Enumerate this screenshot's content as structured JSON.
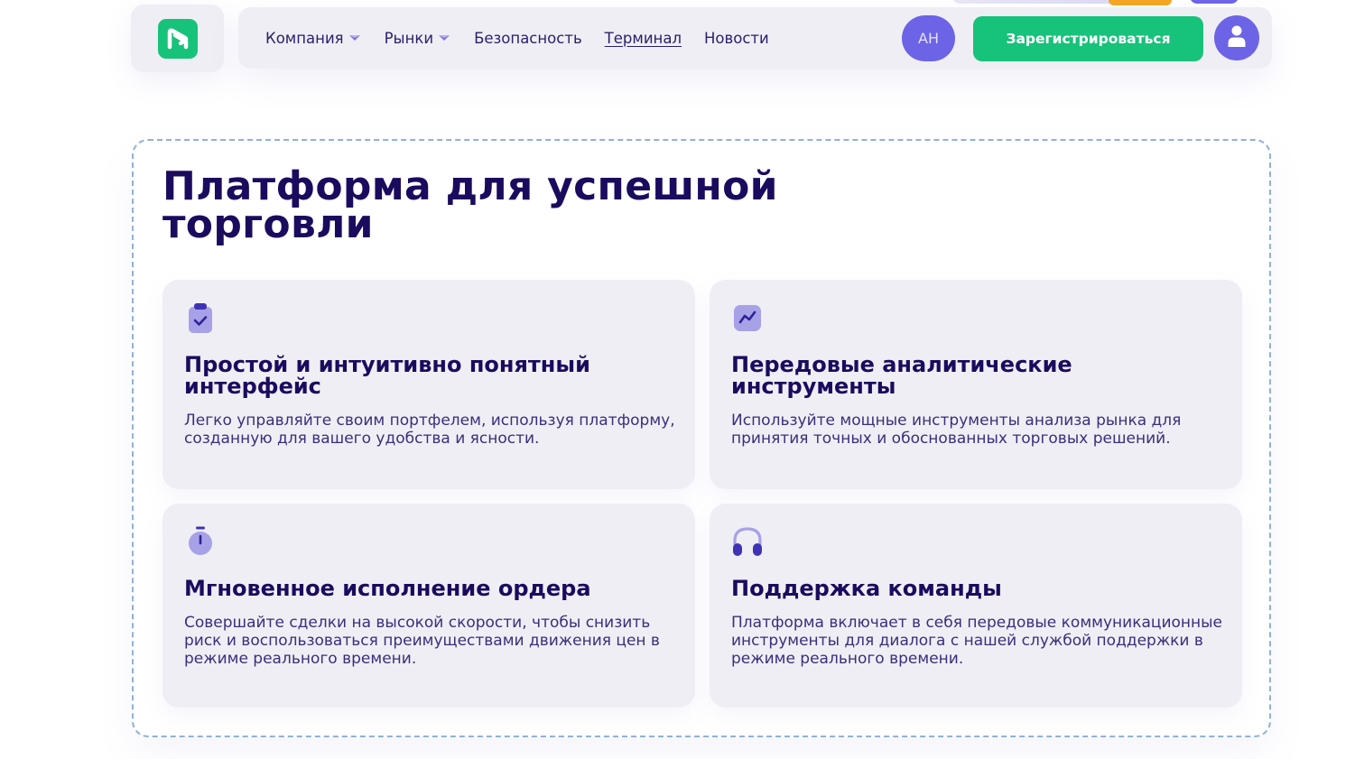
{
  "header": {
    "logo_icon": "brand-logo-icon",
    "nav": [
      {
        "label": "Компания",
        "has_dropdown": true
      },
      {
        "label": "Рынки",
        "has_dropdown": true
      },
      {
        "label": "Безопасность",
        "has_dropdown": false
      },
      {
        "label": "Терминал",
        "has_dropdown": false,
        "underlined": true
      },
      {
        "label": "Новости",
        "has_dropdown": false
      }
    ],
    "lang_label": "AH",
    "register_label": "Зарегистрироваться",
    "user_icon": "user-icon"
  },
  "colors": {
    "brand_green": "#17c27a",
    "accent_purple": "#6c63e6",
    "heading": "#1b0b5e",
    "card_bg": "#efeef4",
    "panel_border": "#8fb2d8"
  },
  "features": {
    "title": "Платформа для успешной торговли",
    "cards": [
      {
        "icon": "clipboard-check-icon",
        "title": "Простой и интуитивно понятный интерфейс",
        "description": "Легко управляйте своим портфелем, используя платформу, созданную для вашего удобства и ясности."
      },
      {
        "icon": "chart-line-icon",
        "title": "Передовые аналитические инструменты",
        "description": "Используйте мощные инструменты анализа рынка для принятия точных и обоснованных торговых решений."
      },
      {
        "icon": "stopwatch-icon",
        "title": "Мгновенное исполнение ордера",
        "description": "Совершайте сделки на высокой скорости, чтобы снизить риск и воспользоваться преимуществами движения цен в режиме реального времени."
      },
      {
        "icon": "headphones-icon",
        "title": "Поддержка команды",
        "description": "Платформа включает в себя передовые коммуникационные инструменты для диалога с нашей службой поддержки в режиме реального времени."
      }
    ]
  }
}
